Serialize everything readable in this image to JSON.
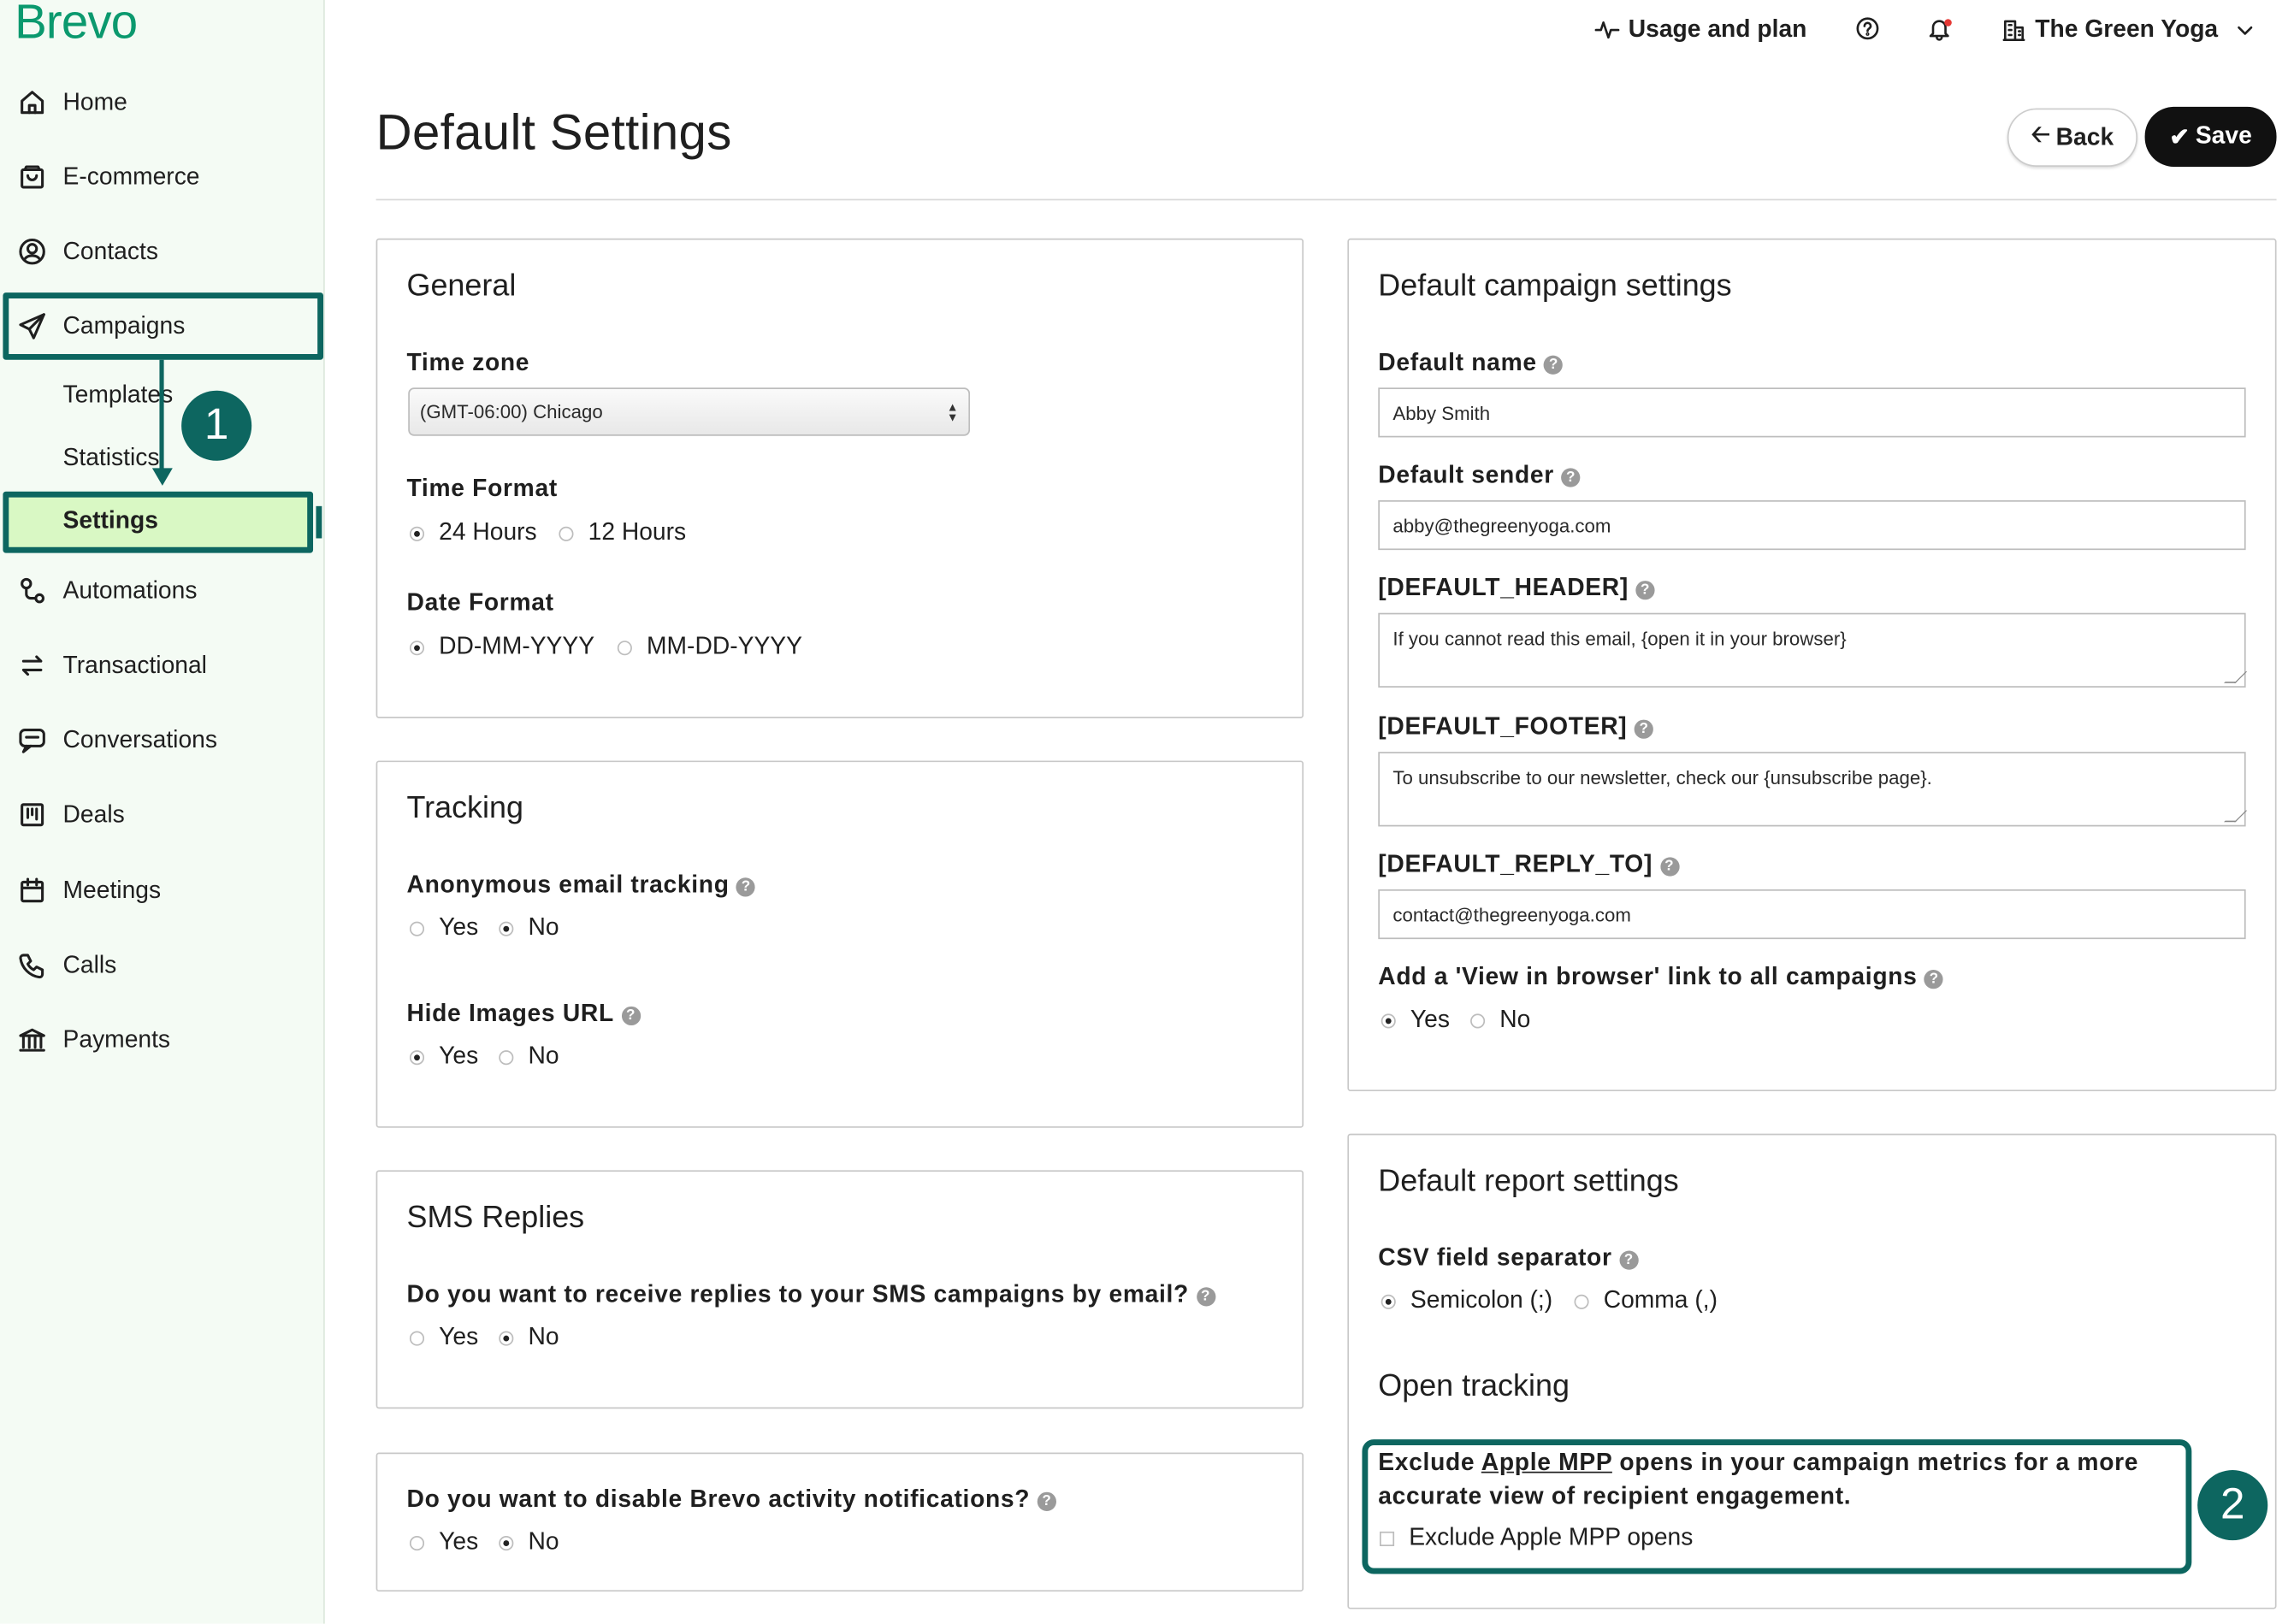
{
  "brand": {
    "logo": "Brevo",
    "accent": "#0b996e",
    "highlight": "#0d6660",
    "active_bg": "#d9f8c4"
  },
  "sidebar": {
    "items": [
      {
        "label": "Home",
        "icon": "home-icon"
      },
      {
        "label": "E-commerce",
        "icon": "shopping-bag-icon"
      },
      {
        "label": "Contacts",
        "icon": "contact-icon"
      },
      {
        "label": "Campaigns",
        "icon": "send-icon"
      },
      {
        "label": "Automations",
        "icon": "automation-icon"
      },
      {
        "label": "Transactional",
        "icon": "transfer-icon"
      },
      {
        "label": "Conversations",
        "icon": "chat-icon"
      },
      {
        "label": "Deals",
        "icon": "board-icon"
      },
      {
        "label": "Meetings",
        "icon": "calendar-icon"
      },
      {
        "label": "Calls",
        "icon": "phone-icon"
      },
      {
        "label": "Payments",
        "icon": "bank-icon"
      }
    ],
    "sub_items": [
      {
        "label": "Templates"
      },
      {
        "label": "Statistics"
      },
      {
        "label": "Settings"
      }
    ],
    "callout_1": "1"
  },
  "topbar": {
    "usage": "Usage and plan",
    "account": "The Green Yoga"
  },
  "page": {
    "title": "Default Settings",
    "back": "Back",
    "save": "Save"
  },
  "general": {
    "title": "General",
    "timezone_label": "Time zone",
    "timezone_value": "(GMT-06:00) Chicago",
    "time_format_label": "Time Format",
    "time_24": "24 Hours",
    "time_12": "12 Hours",
    "date_format_label": "Date Format",
    "date_dmy": "DD-MM-YYYY",
    "date_mdy": "MM-DD-YYYY"
  },
  "tracking": {
    "title": "Tracking",
    "anon_label": "Anonymous email tracking",
    "yes": "Yes",
    "no": "No",
    "hide_images_label": "Hide Images URL"
  },
  "sms": {
    "title": "SMS Replies",
    "question": "Do you want to receive replies to your SMS campaigns by email?",
    "yes": "Yes",
    "no": "No"
  },
  "notifications": {
    "question": "Do you want to disable Brevo activity notifications?",
    "yes": "Yes",
    "no": "No"
  },
  "campaign": {
    "title": "Default campaign settings",
    "name_label": "Default name",
    "name_value": "Abby Smith",
    "sender_label": "Default sender",
    "sender_value": "abby@thegreenyoga.com",
    "header_label": "[DEFAULT_HEADER]",
    "header_value": "If you cannot read this email, {open it in your browser}",
    "footer_label": "[DEFAULT_FOOTER]",
    "footer_value": "To unsubscribe to our newsletter, check our {unsubscribe page}.",
    "reply_label": "[DEFAULT_REPLY_TO]",
    "reply_value": "contact@thegreenyoga.com",
    "browser_link_label": "Add a 'View in browser' link to all campaigns",
    "yes": "Yes",
    "no": "No"
  },
  "report": {
    "title": "Default report settings",
    "csv_label": "CSV field separator",
    "semicolon": "Semicolon (;)",
    "comma": "Comma (,)",
    "open_tracking_title": "Open tracking",
    "mpp_pre": "Exclude",
    "mpp_link": "Apple MPP",
    "mpp_post": "opens in your campaign metrics for a more",
    "mpp_line2": "accurate view of recipient engagement.",
    "mpp_checkbox": "Exclude Apple MPP opens",
    "callout_2": "2"
  }
}
